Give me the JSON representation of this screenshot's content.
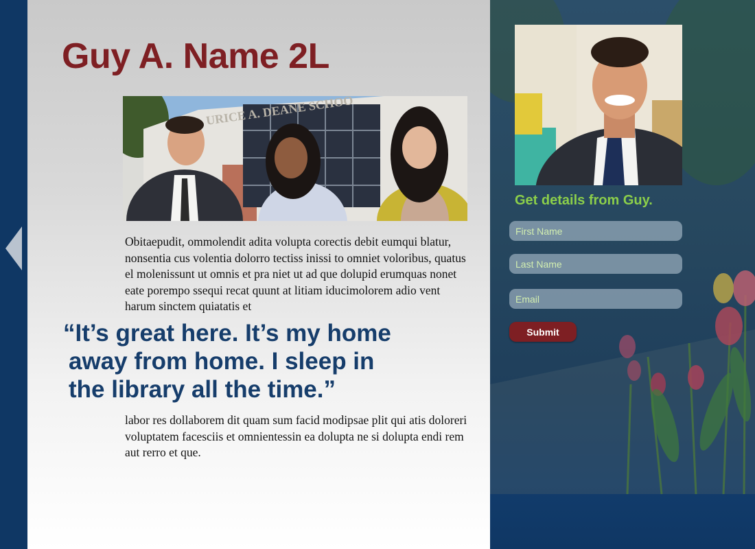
{
  "colors": {
    "navy": "#0f3764",
    "title_red": "#7e1f23",
    "quote_blue": "#163d6b",
    "cta_green": "#8ccf4a",
    "submit_red": "#7e1f23"
  },
  "nav": {
    "prev_icon": "chevron-left-icon"
  },
  "profile": {
    "name_title": "Guy A. Name 2L",
    "group_photo_sign": "URICE A. DEANE SCHOO"
  },
  "article": {
    "paragraph1": "Obitaepudit, ommolendit adita volupta corectis debit eumqui blatur, nonsentia cus volentia dolorro tectiss inissi to omniet voloribus, quatus el molenissunt ut omnis et pra niet ut ad que dolupid erumquas nonet eate porempo ssequi recat quunt at litiam iducimolorem adio vent harum sinctem quiatatis et",
    "quote_line1": "“It’s great here. It’s my home",
    "quote_line2": "away from home. I sleep in",
    "quote_line3": "the library all the time.”",
    "paragraph2": "labor res dollaborem dit quam sum facid modipsae plit qui atis doloreri voluptatem facesciis et omnientessin ea dolupta ne si dolupta endi rem aut rerro et que."
  },
  "form": {
    "cta": "Get details from Guy.",
    "first_name": {
      "placeholder": "First Name",
      "value": ""
    },
    "last_name": {
      "placeholder": "Last Name",
      "value": ""
    },
    "email": {
      "placeholder": "Email",
      "value": ""
    },
    "submit_label": "Submit"
  }
}
